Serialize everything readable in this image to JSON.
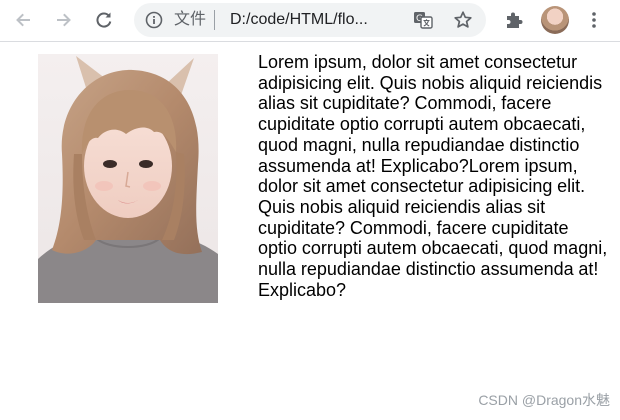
{
  "browser": {
    "scheme_label": "文件",
    "url": "D:/code/HTML/flo..."
  },
  "page": {
    "paragraph": "Lorem ipsum, dolor sit amet consectetur adipisicing elit. Quis nobis aliquid reiciendis alias sit cupiditate? Commodi, facere cupiditate optio corrupti autem obcaecati, quod magni, nulla repudiandae distinctio assumenda at! Explicabo?Lorem ipsum, dolor sit amet consectetur adipisicing elit. Quis nobis aliquid reiciendis alias sit cupiditate? Commodi, facere cupiditate optio corrupti autem obcaecati, quod magni, nulla repudiandae distinctio assumenda at! Explicabo?"
  },
  "watermark": "CSDN @Dragon水魅",
  "icons": {
    "back": "arrow-left-icon",
    "forward": "arrow-right-icon",
    "reload": "reload-icon",
    "info": "info-icon",
    "translate": "translate-icon",
    "bookmark": "star-icon",
    "extensions": "puzzle-icon",
    "menu": "kebab-menu-icon"
  },
  "colors": {
    "toolbar_icon": "#5f6368",
    "toolbar_icon_disabled": "#bdc1c6",
    "omnibox_bg": "#f1f3f4",
    "text": "#000000",
    "watermark": "#9aa0a6"
  }
}
